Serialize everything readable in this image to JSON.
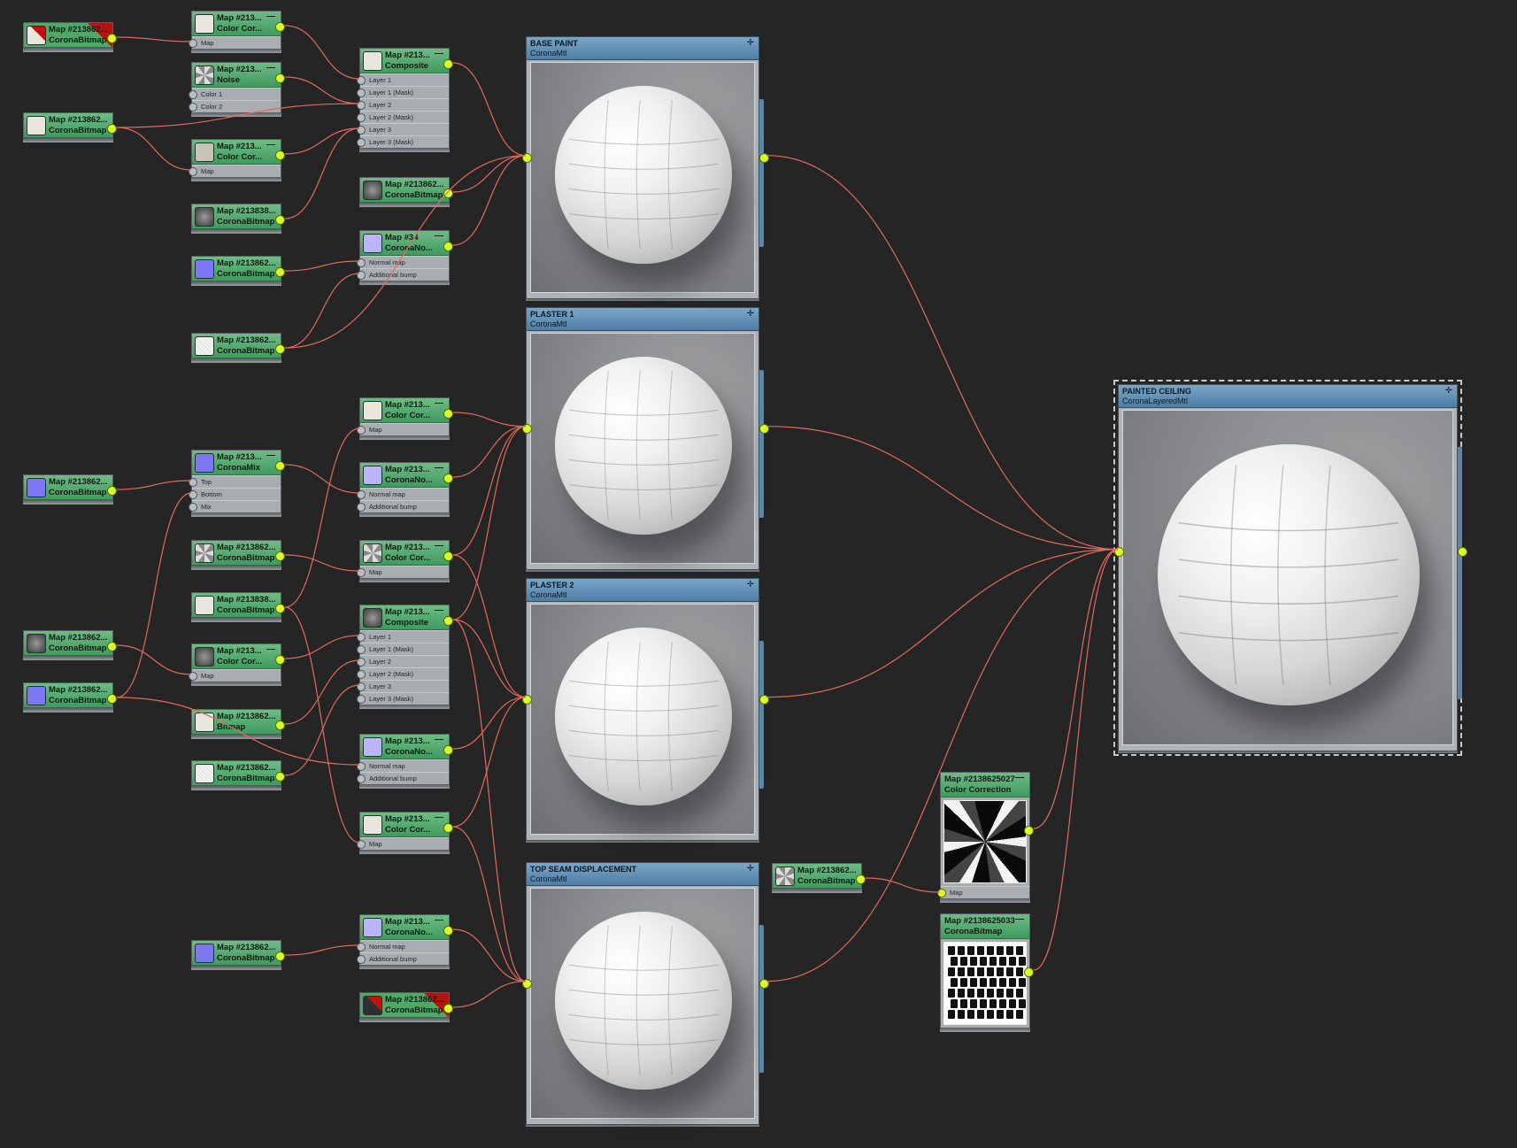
{
  "colors": {
    "background": "#252525",
    "node_header": "#4fa86a",
    "material_header": "#5f8db3",
    "wire": "#e06a5c",
    "socket_active": "#d8ff2a"
  },
  "map_nodes": [
    {
      "id": "n1",
      "line1": "Map #213862...",
      "line2": "CoronaBitmap",
      "thumb": "red-corner",
      "slots": []
    },
    {
      "id": "n2",
      "line1": "Map #213...",
      "line2": "Color Cor...",
      "thumb": "light",
      "slots": [
        "Map"
      ]
    },
    {
      "id": "n3",
      "line1": "Map #213...",
      "line2": "Noise",
      "thumb": "noise",
      "slots": [
        "Color 1",
        "Color 2"
      ]
    },
    {
      "id": "n4",
      "line1": "Map #213...",
      "line2": "Composite",
      "thumb": "light",
      "slots": [
        "Layer 1",
        "Layer 1 (Mask)",
        "Layer 2",
        "Layer 2 (Mask)",
        "Layer 3",
        "Layer 3 (Mask)"
      ]
    },
    {
      "id": "n5",
      "line1": "Map #213862...",
      "line2": "CoronaBitmap",
      "thumb": "light",
      "slots": []
    },
    {
      "id": "n6",
      "line1": "Map #213...",
      "line2": "Color Cor...",
      "thumb": "beige",
      "slots": [
        "Map"
      ]
    },
    {
      "id": "n7",
      "line1": "Map #213862...",
      "line2": "CoronaBitmap",
      "thumb": "dark",
      "slots": []
    },
    {
      "id": "n8",
      "line1": "Map #213838...",
      "line2": "CoronaBitmap",
      "thumb": "dark",
      "slots": []
    },
    {
      "id": "n9",
      "line1": "Map #34",
      "line2": "CoronaNo...",
      "thumb": "lavender",
      "slots": [
        "Normal map",
        "Additional bump"
      ]
    },
    {
      "id": "n10",
      "line1": "Map #213862...",
      "line2": "CoronaBitmap",
      "thumb": "blue",
      "slots": []
    },
    {
      "id": "n11",
      "line1": "Map #213862...",
      "line2": "CoronaBitmap",
      "thumb": "white",
      "slots": []
    },
    {
      "id": "n12",
      "line1": "Map #213...",
      "line2": "Color Cor...",
      "thumb": "light",
      "slots": [
        "Map"
      ]
    },
    {
      "id": "n13",
      "line1": "Map #213...",
      "line2": "CoronaMix",
      "thumb": "blue",
      "slots": [
        "Top",
        "Bottom",
        "Mix"
      ]
    },
    {
      "id": "n14",
      "line1": "Map #213862...",
      "line2": "CoronaBitmap",
      "thumb": "blue",
      "slots": []
    },
    {
      "id": "n15",
      "line1": "Map #213...",
      "line2": "CoronaNo...",
      "thumb": "lavender",
      "slots": [
        "Normal map",
        "Additional bump"
      ]
    },
    {
      "id": "n16",
      "line1": "Map #213862...",
      "line2": "CoronaBitmap",
      "thumb": "noise",
      "slots": []
    },
    {
      "id": "n17",
      "line1": "Map #213...",
      "line2": "Color Cor...",
      "thumb": "noise",
      "slots": [
        "Map"
      ]
    },
    {
      "id": "n18",
      "line1": "Map #213838...",
      "line2": "CoronaBitmap",
      "thumb": "light",
      "slots": []
    },
    {
      "id": "n19",
      "line1": "Map #213...",
      "line2": "Composite",
      "thumb": "dark",
      "slots": [
        "Layer 1",
        "Layer 1 (Mask)",
        "Layer 2",
        "Layer 2 (Mask)",
        "Layer 3",
        "Layer 3 (Mask)"
      ]
    },
    {
      "id": "n20",
      "line1": "Map #213862...",
      "line2": "CoronaBitmap",
      "thumb": "dark",
      "slots": []
    },
    {
      "id": "n21",
      "line1": "Map #213...",
      "line2": "Color Cor...",
      "thumb": "dark",
      "slots": [
        "Map"
      ]
    },
    {
      "id": "n22",
      "line1": "Map #213862...",
      "line2": "CoronaBitmap",
      "thumb": "blue",
      "slots": []
    },
    {
      "id": "n23",
      "line1": "Map #213862...",
      "line2": "Bitmap",
      "thumb": "light",
      "slots": []
    },
    {
      "id": "n24",
      "line1": "Map #213...",
      "line2": "CoronaNo...",
      "thumb": "lavender",
      "slots": [
        "Normal map",
        "Additional bump"
      ]
    },
    {
      "id": "n25",
      "line1": "Map #213862...",
      "line2": "CoronaBitmap",
      "thumb": "white",
      "slots": []
    },
    {
      "id": "n26",
      "line1": "Map #213...",
      "line2": "Color Cor...",
      "thumb": "light",
      "slots": [
        "Map"
      ]
    },
    {
      "id": "n27",
      "line1": "Map #213...",
      "line2": "CoronaNo...",
      "thumb": "lavender",
      "slots": [
        "Normal map",
        "Additional bump"
      ]
    },
    {
      "id": "n28",
      "line1": "Map #213862...",
      "line2": "CoronaBitmap",
      "thumb": "blue",
      "slots": []
    },
    {
      "id": "n29",
      "line1": "Map #213862...",
      "line2": "CoronaBitmap",
      "thumb": "red-corner-dark",
      "slots": []
    },
    {
      "id": "n30",
      "line1": "Map #213862...",
      "line2": "CoronaBitmap",
      "thumb": "noise",
      "slots": []
    }
  ],
  "materials": [
    {
      "id": "m1",
      "title": "BASE PAINT",
      "type": "CoronaMtl",
      "icon": "pin-icon"
    },
    {
      "id": "m2",
      "title": "PLASTER 1",
      "type": "CoronaMtl",
      "icon": "pin-icon"
    },
    {
      "id": "m3",
      "title": "PLASTER 2",
      "type": "CoronaMtl",
      "icon": "pin-icon"
    },
    {
      "id": "m4",
      "title": "TOP SEAM DISPLACEMENT",
      "type": "CoronaMtl",
      "icon": "pin-icon"
    },
    {
      "id": "m5",
      "title": "PAINTED CEILING",
      "type": "CoronaLayeredMtl",
      "icon": "pin-icon"
    }
  ],
  "big_maps": [
    {
      "id": "b1",
      "line1": "Map #2138625027",
      "line2": "Color Correction",
      "slots": [
        "Map"
      ],
      "thumb": "mask-noise"
    },
    {
      "id": "b2",
      "line1": "Map #2138625033",
      "line2": "CoronaBitmap",
      "slots": [],
      "thumb": "mask-tiles"
    }
  ]
}
